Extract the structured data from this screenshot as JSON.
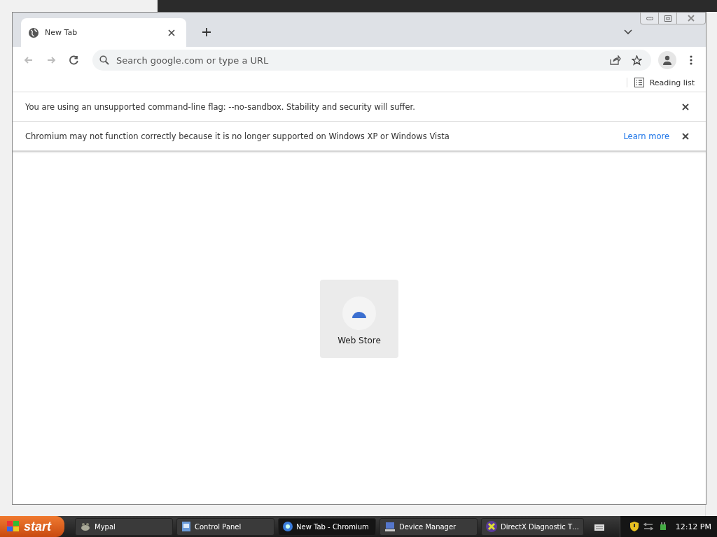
{
  "browser": {
    "tabs": [
      {
        "title": "New Tab",
        "selected": true
      }
    ],
    "nav": [
      {
        "kind": "back",
        "disabled": true
      },
      {
        "kind": "forward",
        "disabled": true
      },
      {
        "kind": "reload",
        "disabled": false
      }
    ],
    "omnibox": {
      "placeholder": "Search google.com or type a URL"
    },
    "reading_list": "Reading list",
    "infobars": [
      {
        "text": "You are using an unsupported command-line flag: --no-sandbox. Stability and security will suffer."
      },
      {
        "text": "Chromium may not function correctly because it is no longer supported on Windows XP or Windows Vista",
        "link": "Learn more"
      }
    ],
    "shortcuts": [
      {
        "label": "Web Store"
      }
    ]
  },
  "taskbar": {
    "start": "start",
    "tasks": [
      {
        "label": "Mypal",
        "selected": false,
        "kind": "mypal"
      },
      {
        "label": "Control Panel",
        "selected": false,
        "kind": "control"
      },
      {
        "label": "New Tab - Chromium",
        "selected": true,
        "kind": "chromium"
      },
      {
        "label": "Device Manager",
        "selected": false,
        "kind": "device"
      },
      {
        "label": "DirectX Diagnostic T…",
        "selected": false,
        "kind": "directx"
      }
    ],
    "clock": "12:12 PM"
  }
}
